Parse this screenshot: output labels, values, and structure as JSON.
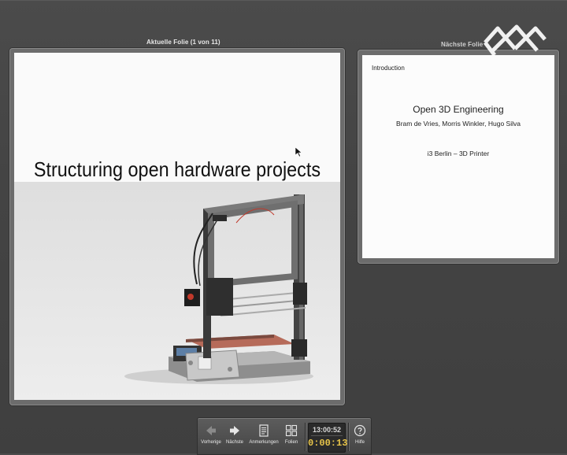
{
  "panes": {
    "current_label": "Aktuelle Folie (1 von 11)",
    "next_label": "Nächste Folie"
  },
  "current_slide": {
    "title": "Structuring open hardware projects",
    "image": "3d-printer-photo"
  },
  "next_slide": {
    "section": "Introduction",
    "title": "Open 3D Engineering",
    "authors": "Bram de Vries, Morris Winkler, Hugo Silva",
    "subtitle": "i3 Berlin – 3D Printer"
  },
  "toolbar": {
    "prev_label": "Vorherige",
    "next_label": "Nächste",
    "notes_label": "Anmerkungen",
    "slides_label": "Folien",
    "help_label": "Hilfe",
    "clock_time": "13:00:52",
    "elapsed_time": "0:00:13"
  },
  "colors": {
    "background": "#454545",
    "elapsed_time": "#e8c54a"
  },
  "icons": {
    "prev": "arrow-left-icon",
    "next": "arrow-right-icon",
    "notes": "notes-icon",
    "slides": "slides-grid-icon",
    "help": "help-icon",
    "logo": "watermark-logo"
  }
}
